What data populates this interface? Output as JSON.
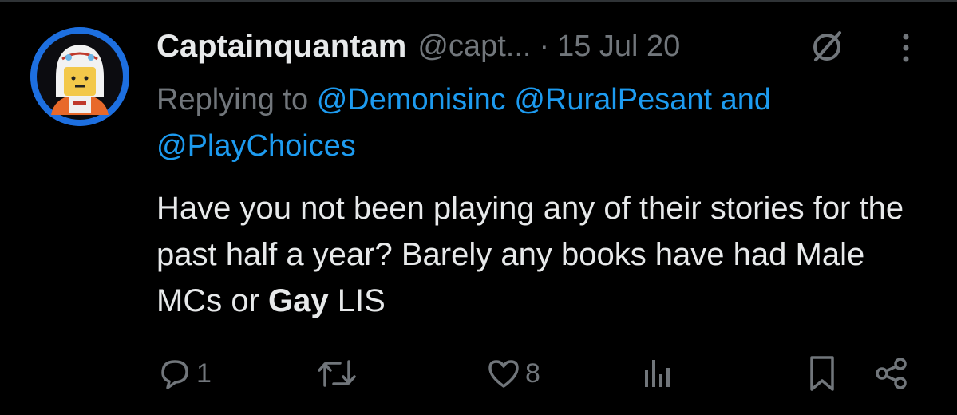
{
  "tweet": {
    "display_name": "Captainquantam",
    "handle": "@capt...",
    "separator": "·",
    "date": "15 Jul 20",
    "reply_prefix": "Replying to",
    "mentions": [
      "@Demonisinc",
      "@RuralPesant"
    ],
    "reply_and": "and",
    "mention_last": "@PlayChoices",
    "text_before_bold": "Have you not been playing any of their stories for the past half a year? Barely any books have had Male MCs or",
    "text_bold": "Gay",
    "text_after_bold": "LIS"
  },
  "actions": {
    "reply_count": "1",
    "retweet_count": "",
    "like_count": "8"
  },
  "icons": {
    "avatar": "lego-pilot-avatar",
    "noadd": "no-add-circle-slash-icon",
    "more": "vertical-dots-icon",
    "reply": "speech-bubble-icon",
    "retweet": "retweet-arrows-icon",
    "like": "heart-icon",
    "views": "bar-chart-icon",
    "bookmark": "bookmark-icon",
    "share": "share-nodes-icon"
  },
  "colors": {
    "background": "#000000",
    "text": "#e7e9ea",
    "secondary": "#71767b",
    "link": "#1d9bf0",
    "avatar_ring": "#1d6fe0"
  }
}
